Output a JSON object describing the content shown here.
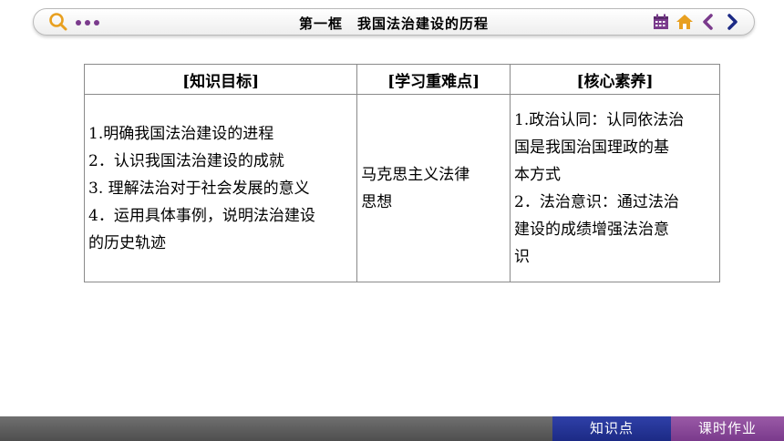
{
  "header": {
    "title": "第一框　我国法治建设的历程"
  },
  "table": {
    "headers": [
      "[知识目标]",
      "[学习重难点]",
      "[核心素养]"
    ],
    "col1_lines": [
      "1.明确我国法治建设的进程",
      "2．认识我国法治建设的成就",
      "3. 理解法治对于社会发展的意义",
      "4．运用具体事例，说明法治建设",
      "的历史轨迹"
    ],
    "col2_lines": [
      "马克思主义法律",
      "思想"
    ],
    "col3_lines": [
      "1.政治认同：认同依法治",
      "国是我国治国理政的基",
      "本方式",
      "2．法治意识：通过法治",
      "建设的成绩增强法治意",
      "识"
    ]
  },
  "footer": {
    "knowledge_label": "知识点",
    "homework_label": "课时作业"
  },
  "colors": {
    "accent_purple": "#7a3a8c",
    "accent_orange": "#e8a020",
    "nav_blue": "#1c2a85"
  },
  "icons": [
    "search-icon",
    "more-dots-icon",
    "calendar-icon",
    "home-icon",
    "back-arrow-icon",
    "forward-arrow-icon"
  ]
}
